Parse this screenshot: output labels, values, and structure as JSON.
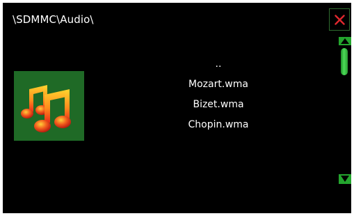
{
  "header": {
    "path": "\\SDMMC\\Audio\\"
  },
  "thumbnail": {
    "icon": "music-notes-icon",
    "background": "#1f6a26"
  },
  "files": [
    {
      "name": ".."
    },
    {
      "name": "Mozart.wma"
    },
    {
      "name": "Bizet.wma"
    },
    {
      "name": "Chopin.wma"
    }
  ],
  "controls": {
    "close_icon": "close-icon",
    "scroll_up_icon": "triangle-up-icon",
    "scroll_down_icon": "triangle-down-icon"
  },
  "colors": {
    "background": "#000000",
    "accent": "#24a52e",
    "close": "#e0282e",
    "text": "#ffffff"
  }
}
